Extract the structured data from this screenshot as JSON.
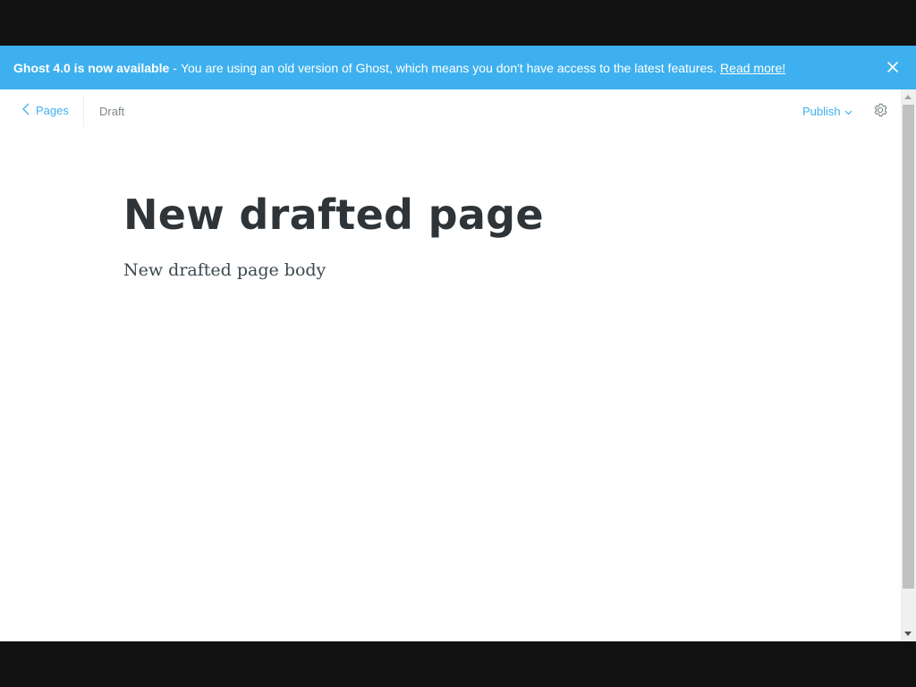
{
  "banner": {
    "strong_text": "Ghost 4.0 is now available",
    "separator": "-",
    "message": "You are using an old version of Ghost, which means you don't have access to the latest features.",
    "link_text": "Read more!",
    "close_icon": "close-icon"
  },
  "header": {
    "back_label": "Pages",
    "back_icon": "chevron-left-icon",
    "status": "Draft",
    "publish_label": "Publish",
    "publish_icon": "chevron-down-icon",
    "settings_icon": "gear-icon"
  },
  "editor": {
    "title": "New drafted page",
    "body": "New drafted page body"
  },
  "colors": {
    "accent": "#3eb0ef",
    "title_text": "#2e3438",
    "muted_text": "#7d878a"
  }
}
